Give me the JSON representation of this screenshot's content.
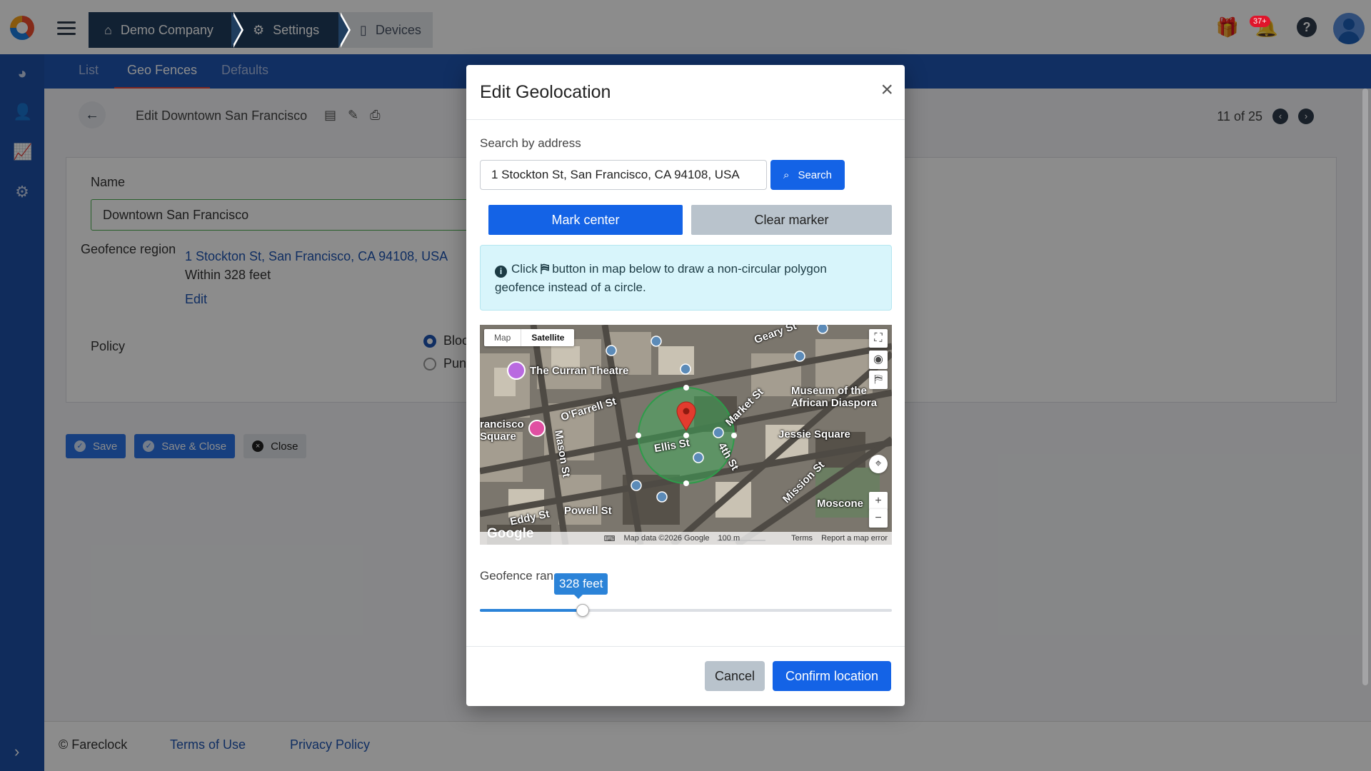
{
  "header": {
    "breadcrumbs": [
      {
        "label": "Demo Company",
        "icon": "home-icon"
      },
      {
        "label": "Settings",
        "icon": "gear-icon"
      },
      {
        "label": "Devices",
        "icon": "phone-icon"
      }
    ],
    "notification_badge": "37+"
  },
  "sidebar": {
    "items": [
      {
        "icon": "dashboard-icon"
      },
      {
        "icon": "person-icon"
      },
      {
        "icon": "chart-icon"
      },
      {
        "icon": "gear-icon"
      }
    ]
  },
  "subnav": {
    "tabs": [
      {
        "label": "List"
      },
      {
        "label": "Geo Fences"
      },
      {
        "label": "Defaults"
      }
    ],
    "active": "Geo Fences"
  },
  "page": {
    "title": "Edit Downtown San Francisco",
    "pager": "11 of 25",
    "name_label": "Name",
    "name_value": "Downtown San Francisco",
    "region_label": "Geofence region",
    "region_address": "1 Stockton St, San Francisco, CA 94108, USA",
    "region_within": "Within 328 feet",
    "region_edit": "Edit",
    "policy_label": "Policy",
    "policy_options": [
      "Block pu",
      "Punches"
    ],
    "save": "Save",
    "save_close": "Save & Close",
    "close": "Close"
  },
  "footer": {
    "copyright": "© Fareclock",
    "terms": "Terms of Use",
    "privacy": "Privacy Policy"
  },
  "modal": {
    "title": "Edit Geolocation",
    "search_label": "Search by address",
    "address_value": "1 Stockton St, San Francisco, CA 94108, USA",
    "search_button": "Search",
    "mark_center": "Mark center",
    "clear_marker": "Clear marker",
    "info_click": "Click",
    "info_rest": "button in map below to draw a non-circular polygon geofence instead of a circle.",
    "map": {
      "tab_map": "Map",
      "tab_satellite": "Satellite",
      "labels": [
        "The Curran Theatre",
        "Geary St",
        "O'Farrell St",
        "Market St",
        "Museum of the",
        "African Diaspora",
        "Jessie Square",
        "Ellis St",
        "4th St",
        "Mason St",
        "Mission St",
        "Moscone",
        "Powell St",
        "Eddy St",
        "rancisco",
        "Square"
      ],
      "attribution": "Map data ©2026 Google",
      "scale": "100 m",
      "terms": "Terms",
      "report": "Report a map error",
      "google": "Google"
    },
    "range_label": "Geofence ran",
    "range_value_text": "328 feet",
    "range_fraction": 0.25,
    "cancel": "Cancel",
    "confirm": "Confirm location"
  }
}
